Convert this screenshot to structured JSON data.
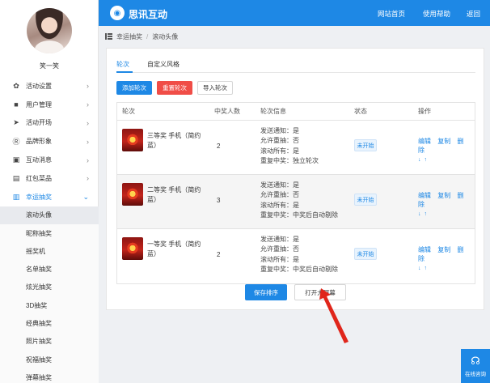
{
  "sidebar": {
    "username": "笑一笑",
    "menu": [
      {
        "label": "活动设置",
        "icon": "gear-icon",
        "glyph": "✿"
      },
      {
        "label": "用户管理",
        "icon": "lock-icon",
        "glyph": "■"
      },
      {
        "label": "活动开场",
        "icon": "send-icon",
        "glyph": "➤"
      },
      {
        "label": "品牌形象",
        "icon": "brand-icon",
        "glyph": "Ⓡ"
      },
      {
        "label": "互动消息",
        "icon": "message-icon",
        "glyph": "▣"
      },
      {
        "label": "红包菜品",
        "icon": "redpacket-icon",
        "glyph": "▤"
      },
      {
        "label": "幸运抽奖",
        "icon": "lottery-icon",
        "glyph": "▥"
      }
    ],
    "submenu": [
      "滚动头像",
      "昵称抽奖",
      "摇奖机",
      "名单抽奖",
      "炫光抽奖",
      "3D抽奖",
      "经典抽奖",
      "照片抽奖",
      "祝福抽奖",
      "弹幕抽奖"
    ]
  },
  "header": {
    "brand": "思讯互动",
    "nav": [
      "网站首页",
      "使用帮助",
      "返回"
    ]
  },
  "breadcrumb": [
    "幸运抽奖",
    "滚动头像"
  ],
  "tabs": [
    "轮次",
    "自定义风格"
  ],
  "toolbar": {
    "add": "添加轮次",
    "reset": "重置轮次",
    "import": "导入轮次"
  },
  "table": {
    "headers": [
      "轮次",
      "中奖人数",
      "轮次信息",
      "状态",
      "操作"
    ],
    "rows": [
      {
        "name": "三等奖 手机（简约蓝）",
        "winners": "2",
        "info": [
          "发送通知：是",
          "允许重抽：否",
          "滚动所有：是",
          "重复中奖：独立轮次"
        ],
        "status": "未开始"
      },
      {
        "name": "二等奖 手机（简约蓝）",
        "winners": "3",
        "info": [
          "发送通知：是",
          "允许重抽：否",
          "滚动所有：是",
          "重复中奖：中奖后自动剔除"
        ],
        "status": "未开始"
      },
      {
        "name": "一等奖 手机（简约蓝）",
        "winners": "2",
        "info": [
          "发送通知：是",
          "允许重抽：否",
          "滚动所有：是",
          "重复中奖：中奖后自动剔除"
        ],
        "status": "未开始"
      }
    ],
    "ops": {
      "edit": "编辑",
      "copy": "复制",
      "delete": "删除",
      "down": "↓",
      "up": "↑"
    }
  },
  "footer_buttons": {
    "save": "保存排序",
    "open_screen": "打开大屏幕"
  },
  "consult": {
    "label": "在线咨询"
  },
  "colors": {
    "primary": "#1e88e5",
    "danger": "#f04d47",
    "annotation": "#e0261b"
  }
}
